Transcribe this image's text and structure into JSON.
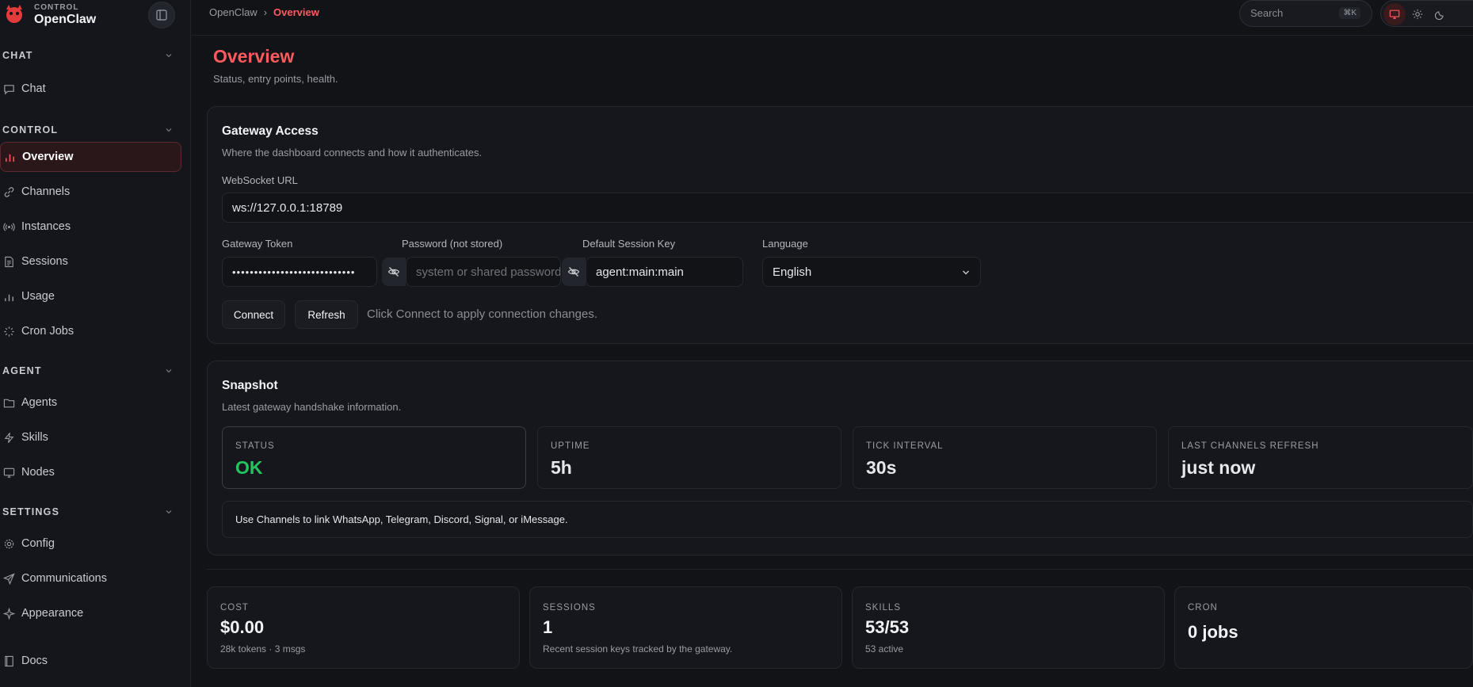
{
  "brand": {
    "sub": "CONTROL",
    "title": "OpenClaw"
  },
  "sidebar": {
    "sections": [
      {
        "header": "CHAT",
        "items": [
          {
            "label": "Chat",
            "icon": "chat-icon"
          }
        ]
      },
      {
        "header": "CONTROL",
        "items": [
          {
            "label": "Overview",
            "icon": "bar-chart-icon",
            "active": true
          },
          {
            "label": "Channels",
            "icon": "link-icon"
          },
          {
            "label": "Instances",
            "icon": "radio-icon"
          },
          {
            "label": "Sessions",
            "icon": "document-icon"
          },
          {
            "label": "Usage",
            "icon": "bar-chart-icon"
          },
          {
            "label": "Cron Jobs",
            "icon": "loader-icon"
          }
        ]
      },
      {
        "header": "AGENT",
        "items": [
          {
            "label": "Agents",
            "icon": "folder-icon"
          },
          {
            "label": "Skills",
            "icon": "zap-icon"
          },
          {
            "label": "Nodes",
            "icon": "monitor-icon"
          }
        ]
      },
      {
        "header": "SETTINGS",
        "items": [
          {
            "label": "Config",
            "icon": "gear-icon"
          },
          {
            "label": "Communications",
            "icon": "send-icon"
          },
          {
            "label": "Appearance",
            "icon": "sparkle-icon"
          }
        ]
      }
    ],
    "footer": {
      "label": "Docs",
      "icon": "book-icon"
    }
  },
  "topbar": {
    "breadcrumb_root": "OpenClaw",
    "breadcrumb_sep": "›",
    "breadcrumb_current": "Overview",
    "search_placeholder": "Search",
    "search_shortcut": "⌘K"
  },
  "page": {
    "title": "Overview",
    "subtitle": "Status, entry points, health."
  },
  "gateway": {
    "title": "Gateway Access",
    "subtitle": "Where the dashboard connects and how it authenticates.",
    "ws_label": "WebSocket URL",
    "ws_value": "ws://127.0.0.1:18789",
    "token_label": "Gateway Token",
    "token_value": "••••••••••••••••••••••••••••",
    "password_label": "Password (not stored)",
    "password_placeholder": "system or shared password",
    "session_label": "Default Session Key",
    "session_value": "agent:main:main",
    "language_label": "Language",
    "language_value": "English",
    "connect_label": "Connect",
    "refresh_label": "Refresh",
    "hint": "Click Connect to apply connection changes."
  },
  "snapshot": {
    "title": "Snapshot",
    "subtitle": "Latest gateway handshake information.",
    "stats": [
      {
        "label": "STATUS",
        "value": "OK"
      },
      {
        "label": "UPTIME",
        "value": "5h"
      },
      {
        "label": "TICK INTERVAL",
        "value": "30s"
      },
      {
        "label": "LAST CHANNELS REFRESH",
        "value": "just now"
      }
    ],
    "info": "Use Channels to link WhatsApp, Telegram, Discord, Signal, or iMessage."
  },
  "metrics": [
    {
      "label": "COST",
      "value": "$0.00",
      "sub": "28k tokens · 3 msgs"
    },
    {
      "label": "SESSIONS",
      "value": "1",
      "sub": "Recent session keys tracked by the gateway."
    },
    {
      "label": "SKILLS",
      "value": "53/53",
      "sub": "53 active"
    },
    {
      "label": "CRON",
      "value": "0 jobs",
      "sub": ""
    }
  ],
  "colors": {
    "accent": "#ff5a5f",
    "ok": "#22c55e",
    "bg": "#121317",
    "card": "#16171c"
  }
}
